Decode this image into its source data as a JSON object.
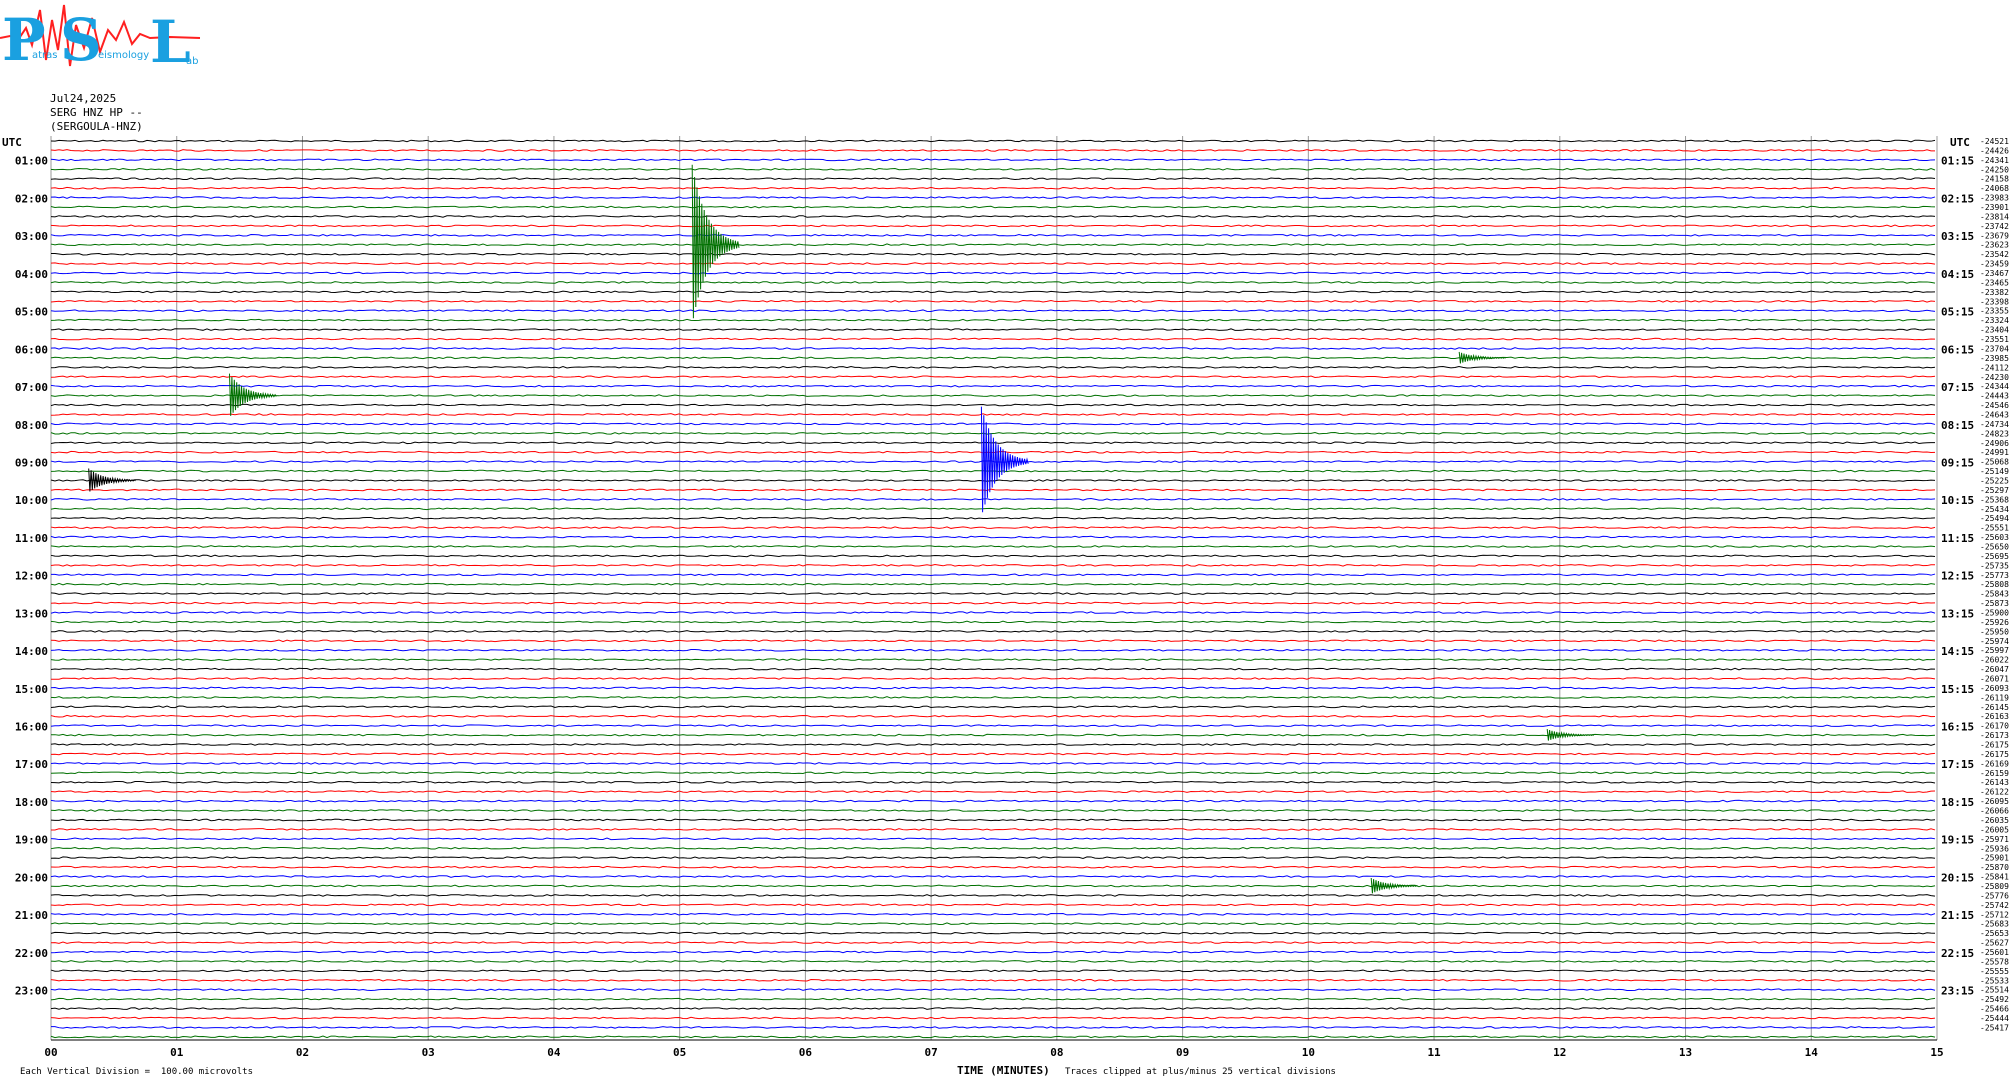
{
  "logo": {
    "text": "PSL",
    "subtitle_a": "atras",
    "subtitle_b": "eismology",
    "subtitle_c": "ab"
  },
  "header": {
    "date": "Jul24,2025",
    "station": "SERG HNZ HP --",
    "station_name": "(SERGOULA-HNZ)"
  },
  "utc_label_left": "UTC",
  "utc_label_right": "UTC",
  "left_hour_labels": [
    "01:00",
    "02:00",
    "03:00",
    "04:00",
    "05:00",
    "06:00",
    "07:00",
    "08:00",
    "09:00",
    "10:00",
    "11:00",
    "12:00",
    "13:00",
    "14:00",
    "15:00",
    "16:00",
    "17:00",
    "18:00",
    "19:00",
    "20:00",
    "21:00",
    "22:00",
    "23:00"
  ],
  "right_hour_labels": [
    "01:15",
    "02:15",
    "03:15",
    "04:15",
    "05:15",
    "06:15",
    "07:15",
    "08:15",
    "09:15",
    "10:15",
    "11:15",
    "12:15",
    "13:15",
    "14:15",
    "15:15",
    "16:15",
    "17:15",
    "18:15",
    "19:15",
    "20:15",
    "21:15",
    "22:15",
    "23:15"
  ],
  "x_tick_labels": [
    "00",
    "01",
    "02",
    "03",
    "04",
    "05",
    "06",
    "07",
    "08",
    "09",
    "10",
    "11",
    "12",
    "13",
    "14",
    "15"
  ],
  "x_axis_title": "TIME (MINUTES)",
  "footer_left": "Each Vertical Division =  100.00 microvolts",
  "footer_clip": "Traces clipped at plus/minus 25 vertical divisions",
  "trace_colors": [
    "#000000",
    "#ff0000",
    "#0000ff",
    "#007000"
  ],
  "right_values": [
    "-24521",
    "-24426",
    "-24341",
    "-24250",
    "-24158",
    "-24068",
    "-23983",
    "-23901",
    "-23814",
    "-23742",
    "-23679",
    "-23623",
    "-23542",
    "-23459",
    "-23467",
    "-23465",
    "-23382",
    "-23398",
    "-23355",
    "-23324",
    "-23404",
    "-23551",
    "-23704",
    "-23985",
    "-24112",
    "-24230",
    "-24344",
    "-24443",
    "-24546",
    "-24643",
    "-24734",
    "-24823",
    "-24906",
    "-24991",
    "-25068",
    "-25149",
    "-25225",
    "-25297",
    "-25368",
    "-25434",
    "-25494",
    "-25551",
    "-25603",
    "-25650",
    "-25695",
    "-25735",
    "-25773",
    "-25808",
    "-25843",
    "-25873",
    "-25900",
    "-25926",
    "-25950",
    "-25974",
    "-25997",
    "-26022",
    "-26047",
    "-26071",
    "-26093",
    "-26119",
    "-26145",
    "-26163",
    "-26170",
    "-26173",
    "-26175",
    "-26175",
    "-26169",
    "-26159",
    "-26143",
    "-26122",
    "-26095",
    "-26066",
    "-26035",
    "-26005",
    "-25971",
    "-25936",
    "-25901",
    "-25870",
    "-25841",
    "-25809",
    "-25776",
    "-25742",
    "-25712",
    "-25683",
    "-25653",
    "-25627",
    "-25601",
    "-25578",
    "-25555",
    "-25533",
    "-25514",
    "-25492",
    "-25466",
    "-25444",
    "-25417"
  ],
  "events": [
    {
      "row": 11,
      "minute": 5.1,
      "amp": 80,
      "color_row": true
    },
    {
      "row": 27,
      "minute": 1.42,
      "amp": 22
    },
    {
      "row": 34,
      "minute": 7.4,
      "amp": 55
    },
    {
      "row": 36,
      "minute": 0.3,
      "amp": 12
    },
    {
      "row": 23,
      "minute": 11.2,
      "amp": 6
    },
    {
      "row": 79,
      "minute": 10.5,
      "amp": 8
    },
    {
      "row": 63,
      "minute": 11.9,
      "amp": 6
    }
  ]
}
